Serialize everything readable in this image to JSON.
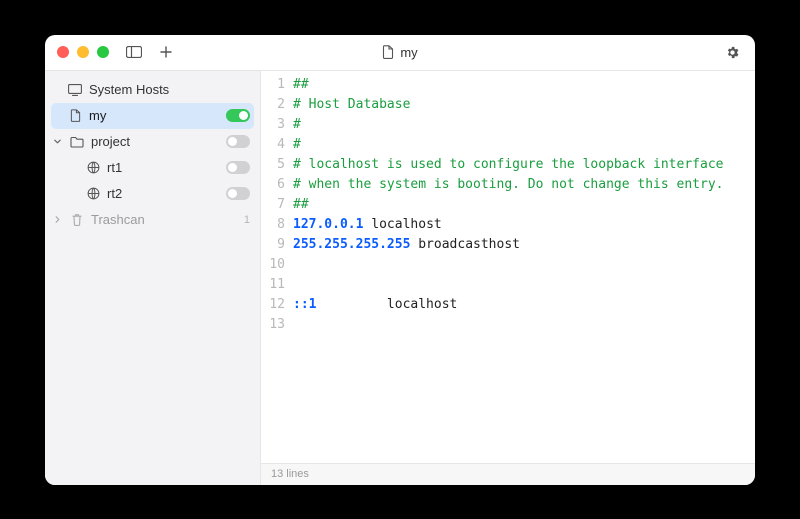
{
  "titlebar": {
    "title": "my"
  },
  "sidebar": {
    "system_hosts": "System Hosts",
    "my": "my",
    "project": "project",
    "rt1": "rt1",
    "rt2": "rt2",
    "trashcan": "Trashcan",
    "trashcan_count": "1"
  },
  "toggles": {
    "my": true,
    "project": false,
    "rt1": false,
    "rt2": false
  },
  "editor": {
    "lines": [
      {
        "n": 1,
        "tokens": [
          {
            "t": "##",
            "c": "comment"
          }
        ]
      },
      {
        "n": 2,
        "tokens": [
          {
            "t": "# Host Database",
            "c": "comment"
          }
        ]
      },
      {
        "n": 3,
        "tokens": [
          {
            "t": "#",
            "c": "comment"
          }
        ]
      },
      {
        "n": 4,
        "tokens": [
          {
            "t": "#",
            "c": "comment"
          }
        ]
      },
      {
        "n": 5,
        "tokens": [
          {
            "t": "# localhost is used to configure the loopback interface",
            "c": "comment"
          }
        ]
      },
      {
        "n": 6,
        "tokens": [
          {
            "t": "# when the system is booting. Do not change this entry.",
            "c": "comment"
          }
        ]
      },
      {
        "n": 7,
        "tokens": [
          {
            "t": "##",
            "c": "comment"
          }
        ]
      },
      {
        "n": 8,
        "tokens": [
          {
            "t": "127.0.0.1",
            "c": "number"
          },
          {
            "t": " localhost",
            "c": "plain"
          }
        ]
      },
      {
        "n": 9,
        "tokens": [
          {
            "t": "255.255.255.255",
            "c": "number"
          },
          {
            "t": " broadcasthost",
            "c": "plain"
          }
        ]
      },
      {
        "n": 10,
        "tokens": [
          {
            "t": "",
            "c": "plain"
          }
        ]
      },
      {
        "n": 11,
        "tokens": [
          {
            "t": "",
            "c": "plain"
          }
        ]
      },
      {
        "n": 12,
        "tokens": [
          {
            "t": "::1",
            "c": "number"
          },
          {
            "t": "         localhost",
            "c": "plain"
          }
        ]
      },
      {
        "n": 13,
        "tokens": [
          {
            "t": "",
            "c": "plain"
          }
        ]
      }
    ]
  },
  "statusbar": {
    "lines_label": "13 lines"
  }
}
